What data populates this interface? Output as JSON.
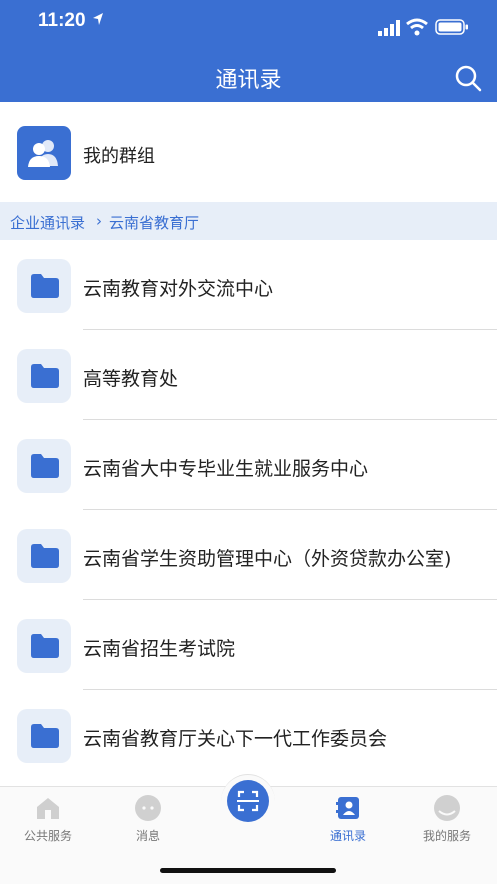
{
  "status_bar": {
    "time": "11:20"
  },
  "header": {
    "title": "通讯录"
  },
  "group": {
    "label": "我的群组"
  },
  "breadcrumb": {
    "root": "企业通讯录",
    "separator": "›",
    "current": "云南省教育厅"
  },
  "items": [
    {
      "label": "云南教育对外交流中心"
    },
    {
      "label": "高等教育处"
    },
    {
      "label": "云南省大中专毕业生就业服务中心"
    },
    {
      "label": "云南省学生资助管理中心（外资贷款办公室)"
    },
    {
      "label": "云南省招生考试院"
    },
    {
      "label": "云南省教育厅关心下一代工作委员会"
    }
  ],
  "tabs": [
    {
      "label": "公共服务",
      "icon": "home-icon"
    },
    {
      "label": "消息",
      "icon": "chat-icon"
    },
    {
      "label": "通讯录",
      "icon": "contacts-icon",
      "active": true
    },
    {
      "label": "我的服务",
      "icon": "profile-icon"
    }
  ],
  "colors": {
    "primary": "#3a6fd2",
    "crumb_bg": "#e7eef8"
  }
}
